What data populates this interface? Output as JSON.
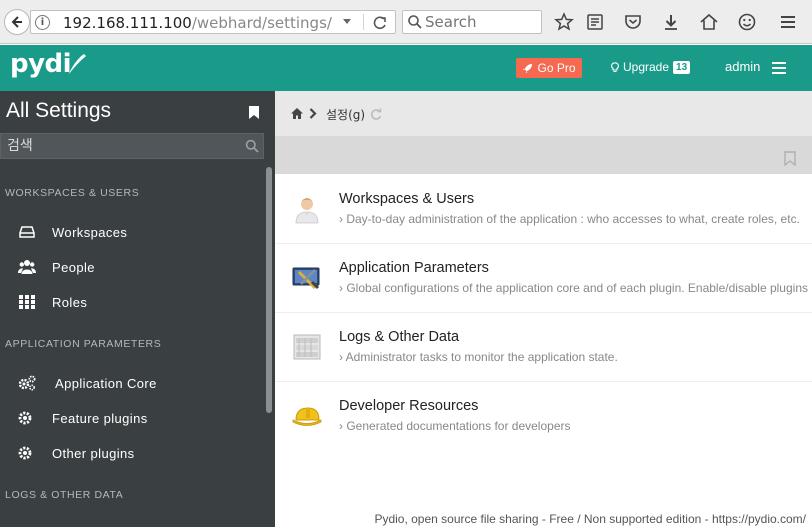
{
  "browser": {
    "url_host": "192.168.111.100",
    "url_path": "/webhard/settings/",
    "search_placeholder": "Search"
  },
  "header": {
    "logo": "pydi",
    "gopro_label": "Go Pro",
    "upgrade_label": "Upgrade",
    "upgrade_count": "13",
    "user": "admin"
  },
  "sidebar": {
    "title": "All Settings",
    "search_placeholder": "검색",
    "sections": [
      {
        "label": "WORKSPACES & USERS",
        "items": [
          {
            "label": "Workspaces",
            "icon": "drive-icon"
          },
          {
            "label": "People",
            "icon": "users-icon"
          },
          {
            "label": "Roles",
            "icon": "grid-icon"
          }
        ]
      },
      {
        "label": "APPLICATION PARAMETERS",
        "items": [
          {
            "label": "Application Core",
            "icon": "cogs-icon"
          },
          {
            "label": "Feature plugins",
            "icon": "gear-icon"
          },
          {
            "label": "Other plugins",
            "icon": "gear-icon"
          }
        ]
      },
      {
        "label": "LOGS & OTHER DATA",
        "items": []
      }
    ]
  },
  "breadcrumb": {
    "current": "설정(g)"
  },
  "cards": [
    {
      "title": "Workspaces & Users",
      "desc": "Day-to-day administration of the application : who accesses to what, create roles, etc.",
      "icon": "user-avatar-icon"
    },
    {
      "title": "Application Parameters",
      "desc": "Global configurations of the application core and of each plugin. Enable/disable plugins",
      "icon": "tools-icon"
    },
    {
      "title": "Logs & Other Data",
      "desc": "Administrator tasks to monitor the application state.",
      "icon": "server-icon"
    },
    {
      "title": "Developer Resources",
      "desc": "Generated documentations for developers",
      "icon": "hardhat-icon"
    }
  ],
  "footer": "Pydio, open source file sharing - Free / Non supported edition - https://pydio.com/",
  "colors": {
    "brand": "#1a9b8a",
    "gopro": "#f4694f",
    "sidebar": "#3a3f42"
  }
}
